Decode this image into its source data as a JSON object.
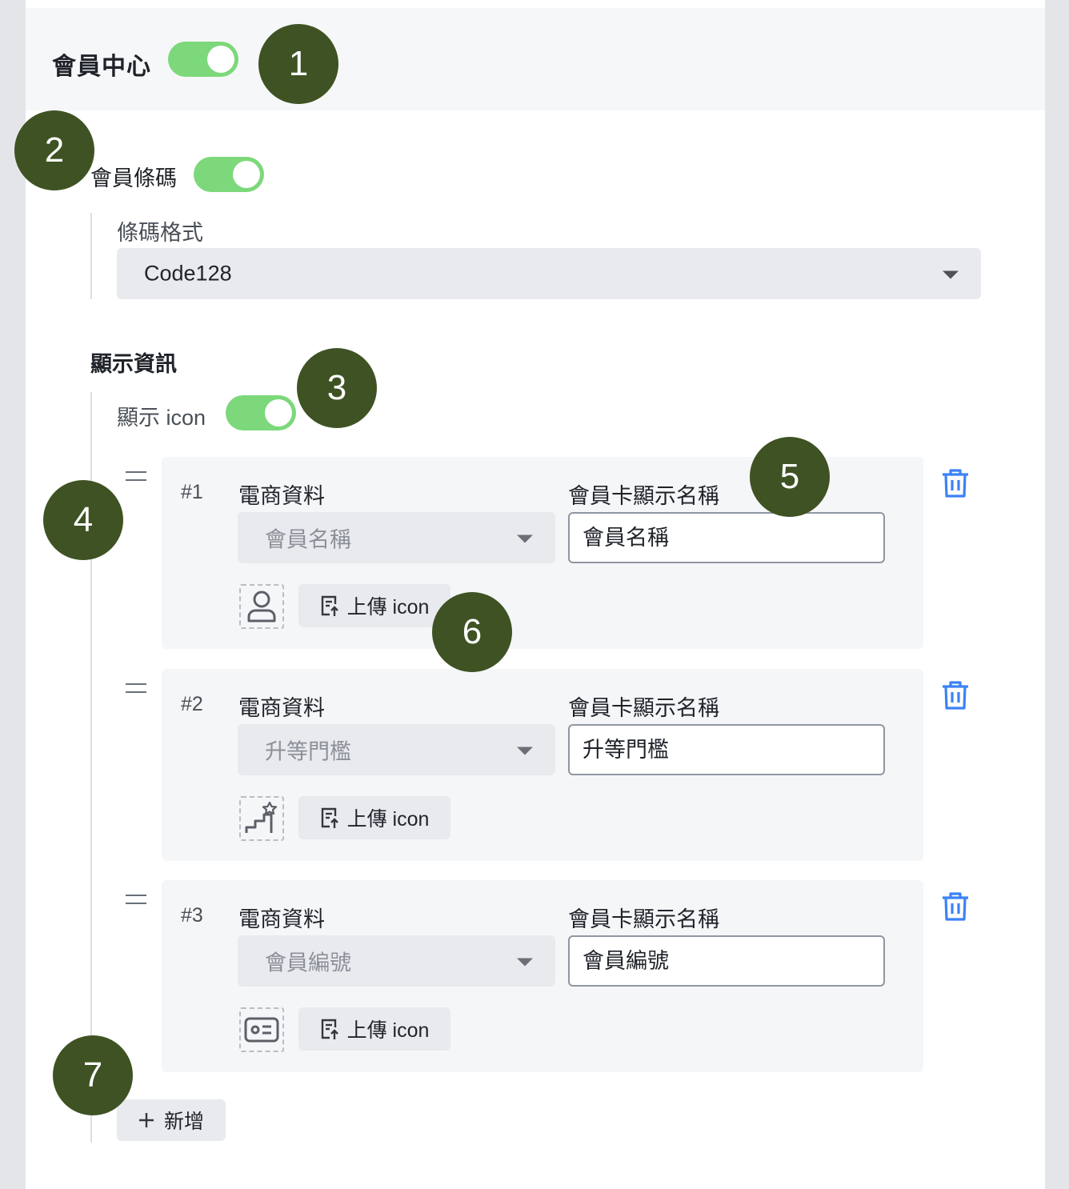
{
  "member_center": {
    "title": "會員中心",
    "enabled": true
  },
  "barcode": {
    "title": "會員條碼",
    "enabled": true,
    "format_label": "條碼格式",
    "format_value": "Code128"
  },
  "display_info": {
    "title": "顯示資訊",
    "show_icon_label": "顯示 icon",
    "show_icon_enabled": true,
    "items": [
      {
        "index": "#1",
        "source_label": "電商資料",
        "source_value": "會員名稱",
        "name_label": "會員卡顯示名稱",
        "name_value": "會員名稱",
        "upload_label": "上傳 icon",
        "icon": "user-icon"
      },
      {
        "index": "#2",
        "source_label": "電商資料",
        "source_value": "升等門檻",
        "name_label": "會員卡顯示名稱",
        "name_value": "升等門檻",
        "upload_label": "上傳 icon",
        "icon": "stairs-star-icon"
      },
      {
        "index": "#3",
        "source_label": "電商資料",
        "source_value": "會員編號",
        "name_label": "會員卡顯示名稱",
        "name_value": "會員編號",
        "upload_label": "上傳 icon",
        "icon": "id-card-icon"
      }
    ],
    "add_label": "新增"
  },
  "markers": [
    "1",
    "2",
    "3",
    "4",
    "5",
    "6",
    "7"
  ],
  "colors": {
    "toggle_on": "#7cd87a",
    "accent_blue": "#3b82f6",
    "marker": "#3f5223"
  }
}
